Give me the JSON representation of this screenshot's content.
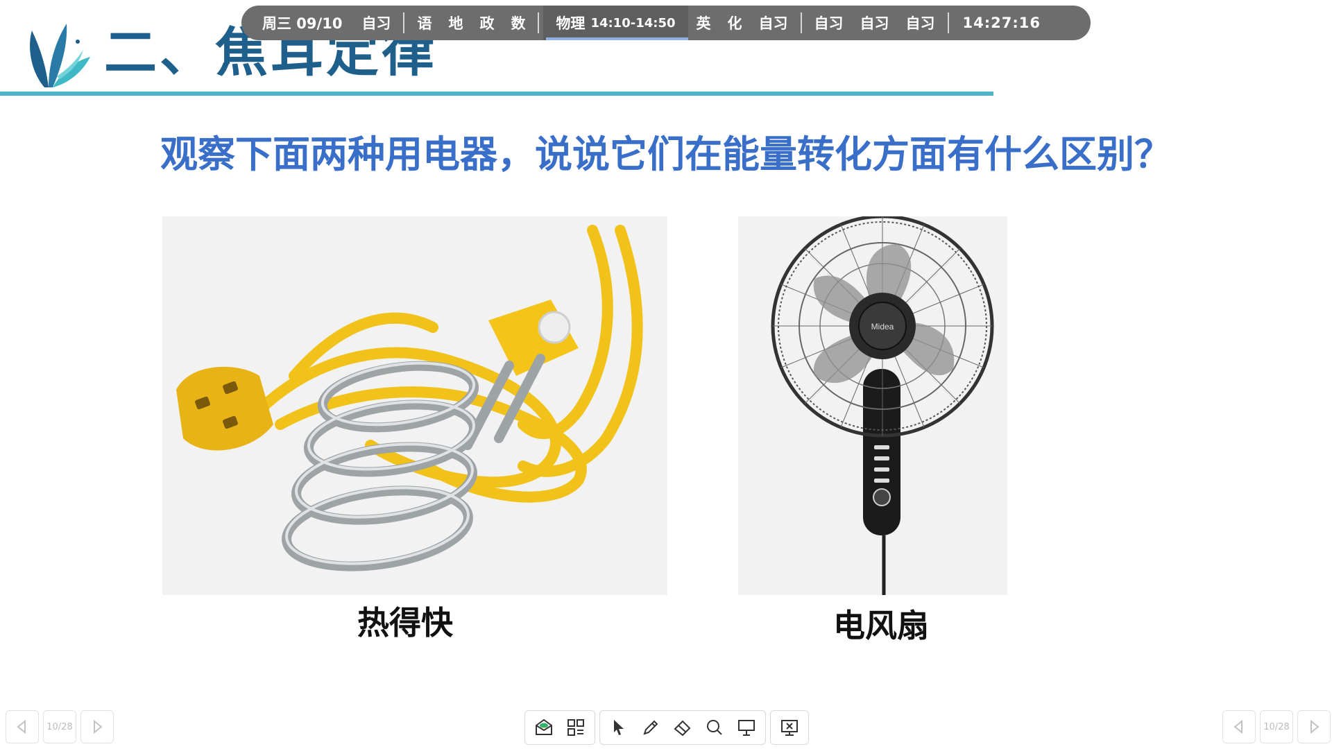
{
  "slide": {
    "title": "二、焦耳定律",
    "question": "观察下面两种用电器，说说它们在能量转化方面有什么区别？",
    "left_caption": "热得快",
    "right_caption": "电风扇",
    "fan_brand": "Midea"
  },
  "schedule": {
    "date": "周三 09/10",
    "group1": [
      "自习"
    ],
    "group2": [
      "语",
      "地",
      "政",
      "数"
    ],
    "current": {
      "subject": "物理",
      "time": "14:10-14:50",
      "progress": 0.45
    },
    "group3": [
      "英",
      "化",
      "自习"
    ],
    "group4": [
      "自习",
      "自习",
      "自习"
    ],
    "clock": "14:27:16"
  },
  "nav": {
    "left_page": "10/28",
    "right_page": "10/28"
  },
  "toolbar": {
    "icons": [
      "message-icon",
      "apps-grid-icon",
      "pointer-icon",
      "pen-icon",
      "eraser-icon",
      "search-icon",
      "board-icon",
      "close-slideshow-icon"
    ]
  },
  "colors": {
    "title": "#1f5f8b",
    "question": "#3a6fc9",
    "rule": "#4fb3c8",
    "schedule_bg": "#6d6d6d",
    "progress": "#2f66d0"
  }
}
